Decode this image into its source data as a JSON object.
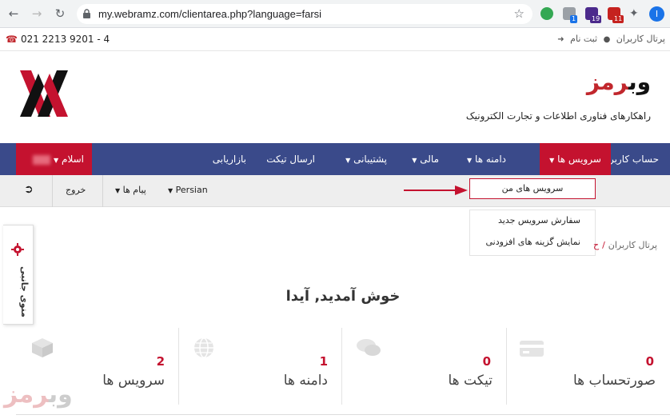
{
  "browser": {
    "url": "my.webramz.com/clientarea.php?language=farsi",
    "ext_badges": [
      "1",
      "19",
      "11"
    ],
    "profile_initial": "I"
  },
  "topbar": {
    "phone": "021 2213 9201 - 4",
    "links": [
      "پرتال کاربران",
      "ثبت نام"
    ]
  },
  "brand": {
    "name_dark": "وب",
    "name_red": "رمز",
    "tagline": "راهکارهای فناوری اطلاعات و تجارت الکترونیک"
  },
  "mainnav": {
    "items": [
      "حساب کاربری",
      "سرویس ها",
      "دامنه ها",
      "مالی",
      "پشتیبانی",
      "ارسال تیکت",
      "بازاریابی"
    ],
    "user_label": "اسلام"
  },
  "subnav": {
    "logout": "خروج",
    "messages": "پیام ها",
    "language": "Persian"
  },
  "dropdown": {
    "items": [
      "سرویس های من",
      "سفارش سرویس جدید",
      "نمایش گزینه های افزودنی"
    ]
  },
  "breadcrumb": {
    "home": "پرتال کاربران",
    "current": "ح"
  },
  "sidemenu": {
    "label": "منوی جانبی"
  },
  "welcome": "خوش آمدید, آیدا",
  "stats": [
    {
      "count": "0",
      "label": "صورتحساب ها",
      "icon": "credit-card-icon"
    },
    {
      "count": "0",
      "label": "تیکت ها",
      "icon": "comments-icon"
    },
    {
      "count": "1",
      "label": "دامنه ها",
      "icon": "globe-icon"
    },
    {
      "count": "2",
      "label": "سرویس ها",
      "icon": "cube-icon"
    }
  ],
  "watermark": {
    "dark": "وب",
    "red": "رمز"
  },
  "colors": {
    "nav": "#3a4a8a",
    "accent": "#c4122f"
  }
}
